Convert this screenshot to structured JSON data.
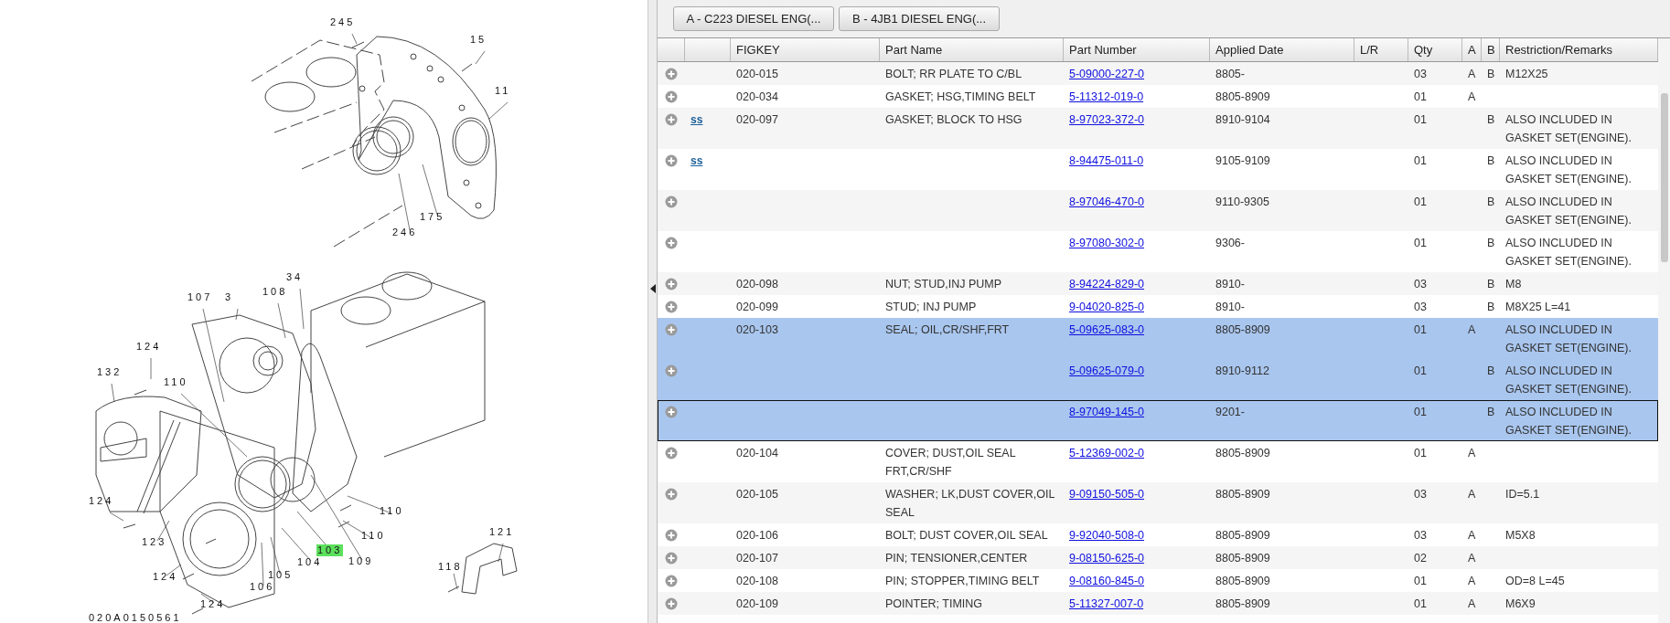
{
  "diagram": {
    "labels": [
      {
        "text": "245",
        "highlighted": false
      },
      {
        "text": "15",
        "highlighted": false
      },
      {
        "text": "11",
        "highlighted": false
      },
      {
        "text": "175",
        "highlighted": false
      },
      {
        "text": "246",
        "highlighted": false
      },
      {
        "text": "34",
        "highlighted": false
      },
      {
        "text": "107",
        "highlighted": false
      },
      {
        "text": "3",
        "highlighted": false
      },
      {
        "text": "108",
        "highlighted": false
      },
      {
        "text": "124",
        "highlighted": false
      },
      {
        "text": "132",
        "highlighted": false
      },
      {
        "text": "110",
        "highlighted": false
      },
      {
        "text": "124",
        "highlighted": false
      },
      {
        "text": "123",
        "highlighted": false
      },
      {
        "text": "124",
        "highlighted": false
      },
      {
        "text": "124",
        "highlighted": false
      },
      {
        "text": "110",
        "highlighted": false
      },
      {
        "text": "110",
        "highlighted": false
      },
      {
        "text": "103",
        "highlighted": true
      },
      {
        "text": "104",
        "highlighted": false
      },
      {
        "text": "105",
        "highlighted": false
      },
      {
        "text": "106",
        "highlighted": false
      },
      {
        "text": "109",
        "highlighted": false
      },
      {
        "text": "121",
        "highlighted": false
      },
      {
        "text": "118",
        "highlighted": false
      }
    ],
    "code": "020A0150561"
  },
  "model_buttons": [
    "A - C223 DIESEL ENG(...",
    "B - 4JB1 DIESEL ENG(..."
  ],
  "columns": [
    "FIGKEY",
    "Part Name",
    "Part Number",
    "Applied Date",
    "L/R",
    "Qty",
    "A",
    "B",
    "Restriction/Remarks"
  ],
  "rows": [
    {
      "figkey": "020-015",
      "part_name": "BOLT; RR PLATE TO C/BL",
      "part_number": "5-09000-227-0",
      "applied_date": "8805-",
      "qty": "03",
      "a": "A",
      "b": "B",
      "remarks": "M12X25",
      "selected": false,
      "focused": false
    },
    {
      "figkey": "020-034",
      "part_name": "GASKET; HSG,TIMING BELT",
      "part_number": "5-11312-019-0",
      "applied_date": "8805-8909",
      "qty": "01",
      "a": "A",
      "selected": false,
      "focused": false
    },
    {
      "link": "ss",
      "figkey": "020-097",
      "part_name": "GASKET; BLOCK TO HSG",
      "part_number": "8-97023-372-0",
      "applied_date": "8910-9104",
      "qty": "01",
      "b": "B",
      "remarks": "ALSO INCLUDED IN GASKET SET(ENGINE).",
      "selected": false,
      "focused": false
    },
    {
      "link": "ss",
      "part_number": "8-94475-011-0",
      "applied_date": "9105-9109",
      "qty": "01",
      "b": "B",
      "remarks": "ALSO INCLUDED IN GASKET SET(ENGINE).",
      "selected": false,
      "focused": false
    },
    {
      "part_number": "8-97046-470-0",
      "applied_date": "9110-9305",
      "qty": "01",
      "b": "B",
      "remarks": "ALSO INCLUDED IN GASKET SET(ENGINE).",
      "selected": false,
      "focused": false
    },
    {
      "part_number": "8-97080-302-0",
      "applied_date": "9306-",
      "qty": "01",
      "b": "B",
      "remarks": "ALSO INCLUDED IN GASKET SET(ENGINE).",
      "selected": false,
      "focused": false
    },
    {
      "figkey": "020-098",
      "part_name": "NUT; STUD,INJ PUMP",
      "part_number": "8-94224-829-0",
      "applied_date": "8910-",
      "qty": "03",
      "b": "B",
      "remarks": "M8",
      "selected": false,
      "focused": false
    },
    {
      "figkey": "020-099",
      "part_name": "STUD; INJ PUMP",
      "part_number": "9-04020-825-0",
      "applied_date": "8910-",
      "qty": "03",
      "b": "B",
      "remarks": "M8X25 L=41",
      "selected": false,
      "focused": false
    },
    {
      "figkey": "020-103",
      "part_name": "SEAL; OIL,CR/SHF,FRT",
      "part_number": "5-09625-083-0",
      "applied_date": "8805-8909",
      "qty": "01",
      "a": "A",
      "remarks": "ALSO INCLUDED IN GASKET SET(ENGINE).",
      "selected": true,
      "focused": false
    },
    {
      "part_number": "5-09625-079-0",
      "applied_date": "8910-9112",
      "qty": "01",
      "b": "B",
      "remarks": "ALSO INCLUDED IN GASKET SET(ENGINE).",
      "selected": true,
      "focused": false
    },
    {
      "part_number": "8-97049-145-0",
      "applied_date": "9201-",
      "qty": "01",
      "b": "B",
      "remarks": "ALSO INCLUDED IN GASKET SET(ENGINE).",
      "selected": true,
      "focused": true
    },
    {
      "figkey": "020-104",
      "part_name": "COVER; DUST,OIL SEAL FRT,CR/SHF",
      "part_number": "5-12369-002-0",
      "applied_date": "8805-8909",
      "qty": "01",
      "a": "A",
      "selected": false,
      "focused": false
    },
    {
      "figkey": "020-105",
      "part_name": "WASHER; LK,DUST COVER,OIL SEAL",
      "part_number": "9-09150-505-0",
      "applied_date": "8805-8909",
      "qty": "03",
      "a": "A",
      "remarks": "ID=5.1",
      "selected": false,
      "focused": false
    },
    {
      "figkey": "020-106",
      "part_name": "BOLT; DUST COVER,OIL SEAL",
      "part_number": "9-92040-508-0",
      "applied_date": "8805-8909",
      "qty": "03",
      "a": "A",
      "remarks": "M5X8",
      "selected": false,
      "focused": false
    },
    {
      "figkey": "020-107",
      "part_name": "PIN; TENSIONER,CENTER",
      "part_number": "9-08150-625-0",
      "applied_date": "8805-8909",
      "qty": "02",
      "a": "A",
      "selected": false,
      "focused": false
    },
    {
      "figkey": "020-108",
      "part_name": "PIN; STOPPER,TIMING BELT",
      "part_number": "9-08160-845-0",
      "applied_date": "8805-8909",
      "qty": "01",
      "a": "A",
      "remarks": "OD=8 L=45",
      "selected": false,
      "focused": false
    },
    {
      "figkey": "020-109",
      "part_name": "POINTER; TIMING",
      "part_number": "5-11327-007-0",
      "applied_date": "8805-8909",
      "qty": "01",
      "a": "A",
      "remarks": "M6X9",
      "selected": false,
      "focused": false
    }
  ]
}
